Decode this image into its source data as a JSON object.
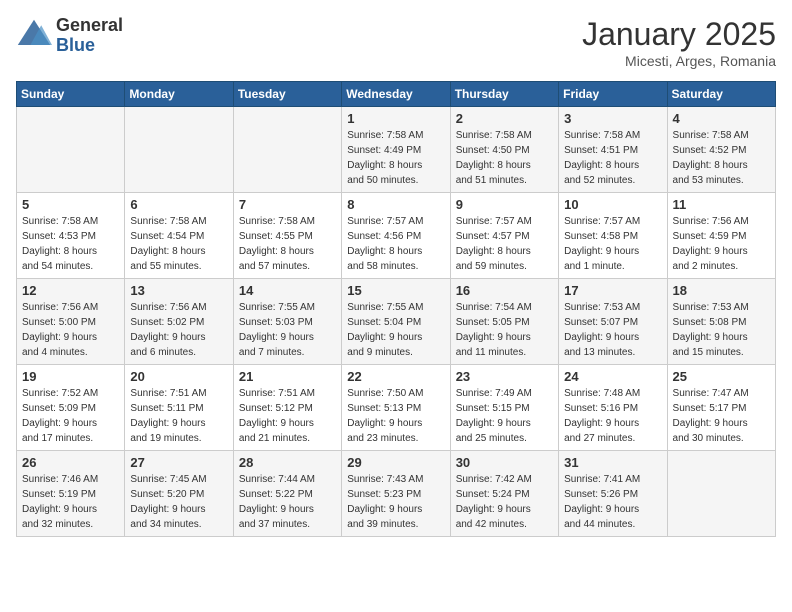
{
  "header": {
    "logo_general": "General",
    "logo_blue": "Blue",
    "month_title": "January 2025",
    "location": "Micesti, Arges, Romania"
  },
  "days_of_week": [
    "Sunday",
    "Monday",
    "Tuesday",
    "Wednesday",
    "Thursday",
    "Friday",
    "Saturday"
  ],
  "weeks": [
    [
      {
        "day": "",
        "info": ""
      },
      {
        "day": "",
        "info": ""
      },
      {
        "day": "",
        "info": ""
      },
      {
        "day": "1",
        "info": "Sunrise: 7:58 AM\nSunset: 4:49 PM\nDaylight: 8 hours\nand 50 minutes."
      },
      {
        "day": "2",
        "info": "Sunrise: 7:58 AM\nSunset: 4:50 PM\nDaylight: 8 hours\nand 51 minutes."
      },
      {
        "day": "3",
        "info": "Sunrise: 7:58 AM\nSunset: 4:51 PM\nDaylight: 8 hours\nand 52 minutes."
      },
      {
        "day": "4",
        "info": "Sunrise: 7:58 AM\nSunset: 4:52 PM\nDaylight: 8 hours\nand 53 minutes."
      }
    ],
    [
      {
        "day": "5",
        "info": "Sunrise: 7:58 AM\nSunset: 4:53 PM\nDaylight: 8 hours\nand 54 minutes."
      },
      {
        "day": "6",
        "info": "Sunrise: 7:58 AM\nSunset: 4:54 PM\nDaylight: 8 hours\nand 55 minutes."
      },
      {
        "day": "7",
        "info": "Sunrise: 7:58 AM\nSunset: 4:55 PM\nDaylight: 8 hours\nand 57 minutes."
      },
      {
        "day": "8",
        "info": "Sunrise: 7:57 AM\nSunset: 4:56 PM\nDaylight: 8 hours\nand 58 minutes."
      },
      {
        "day": "9",
        "info": "Sunrise: 7:57 AM\nSunset: 4:57 PM\nDaylight: 8 hours\nand 59 minutes."
      },
      {
        "day": "10",
        "info": "Sunrise: 7:57 AM\nSunset: 4:58 PM\nDaylight: 9 hours\nand 1 minute."
      },
      {
        "day": "11",
        "info": "Sunrise: 7:56 AM\nSunset: 4:59 PM\nDaylight: 9 hours\nand 2 minutes."
      }
    ],
    [
      {
        "day": "12",
        "info": "Sunrise: 7:56 AM\nSunset: 5:00 PM\nDaylight: 9 hours\nand 4 minutes."
      },
      {
        "day": "13",
        "info": "Sunrise: 7:56 AM\nSunset: 5:02 PM\nDaylight: 9 hours\nand 6 minutes."
      },
      {
        "day": "14",
        "info": "Sunrise: 7:55 AM\nSunset: 5:03 PM\nDaylight: 9 hours\nand 7 minutes."
      },
      {
        "day": "15",
        "info": "Sunrise: 7:55 AM\nSunset: 5:04 PM\nDaylight: 9 hours\nand 9 minutes."
      },
      {
        "day": "16",
        "info": "Sunrise: 7:54 AM\nSunset: 5:05 PM\nDaylight: 9 hours\nand 11 minutes."
      },
      {
        "day": "17",
        "info": "Sunrise: 7:53 AM\nSunset: 5:07 PM\nDaylight: 9 hours\nand 13 minutes."
      },
      {
        "day": "18",
        "info": "Sunrise: 7:53 AM\nSunset: 5:08 PM\nDaylight: 9 hours\nand 15 minutes."
      }
    ],
    [
      {
        "day": "19",
        "info": "Sunrise: 7:52 AM\nSunset: 5:09 PM\nDaylight: 9 hours\nand 17 minutes."
      },
      {
        "day": "20",
        "info": "Sunrise: 7:51 AM\nSunset: 5:11 PM\nDaylight: 9 hours\nand 19 minutes."
      },
      {
        "day": "21",
        "info": "Sunrise: 7:51 AM\nSunset: 5:12 PM\nDaylight: 9 hours\nand 21 minutes."
      },
      {
        "day": "22",
        "info": "Sunrise: 7:50 AM\nSunset: 5:13 PM\nDaylight: 9 hours\nand 23 minutes."
      },
      {
        "day": "23",
        "info": "Sunrise: 7:49 AM\nSunset: 5:15 PM\nDaylight: 9 hours\nand 25 minutes."
      },
      {
        "day": "24",
        "info": "Sunrise: 7:48 AM\nSunset: 5:16 PM\nDaylight: 9 hours\nand 27 minutes."
      },
      {
        "day": "25",
        "info": "Sunrise: 7:47 AM\nSunset: 5:17 PM\nDaylight: 9 hours\nand 30 minutes."
      }
    ],
    [
      {
        "day": "26",
        "info": "Sunrise: 7:46 AM\nSunset: 5:19 PM\nDaylight: 9 hours\nand 32 minutes."
      },
      {
        "day": "27",
        "info": "Sunrise: 7:45 AM\nSunset: 5:20 PM\nDaylight: 9 hours\nand 34 minutes."
      },
      {
        "day": "28",
        "info": "Sunrise: 7:44 AM\nSunset: 5:22 PM\nDaylight: 9 hours\nand 37 minutes."
      },
      {
        "day": "29",
        "info": "Sunrise: 7:43 AM\nSunset: 5:23 PM\nDaylight: 9 hours\nand 39 minutes."
      },
      {
        "day": "30",
        "info": "Sunrise: 7:42 AM\nSunset: 5:24 PM\nDaylight: 9 hours\nand 42 minutes."
      },
      {
        "day": "31",
        "info": "Sunrise: 7:41 AM\nSunset: 5:26 PM\nDaylight: 9 hours\nand 44 minutes."
      },
      {
        "day": "",
        "info": ""
      }
    ]
  ]
}
